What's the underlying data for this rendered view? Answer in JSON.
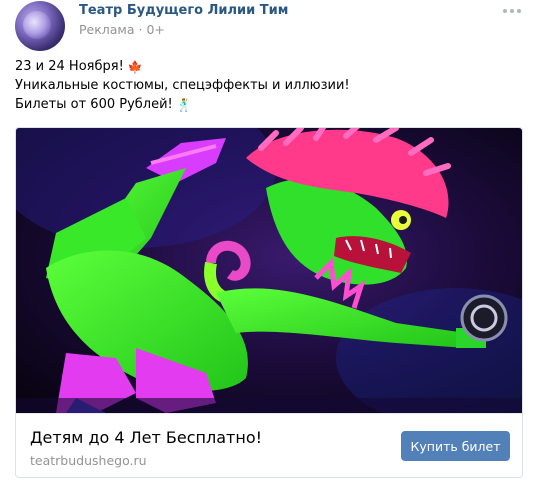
{
  "post": {
    "author": "Театр Будущего Лилии Тим",
    "meta": "Реклама · 0+",
    "lines": [
      "23 и 24 Ноября!",
      "Уникальные костюмы, спецэффекты и иллюзии!",
      "Билеты от 600 Рублей!"
    ],
    "line_emojis": [
      "🍁",
      "",
      "🕺"
    ]
  },
  "card": {
    "title": "Детям до 4 Лет Бесплатно!",
    "domain": "teatrbudushego.ru",
    "button_label": "Купить билет"
  },
  "icons": {
    "more": "more-horizontal-icon",
    "maple": "maple-leaf-icon",
    "dancer": "dancer-icon"
  },
  "colors": {
    "author_link": "#2a5885",
    "meta_gray": "#939393",
    "button_bg": "#5181b8"
  }
}
